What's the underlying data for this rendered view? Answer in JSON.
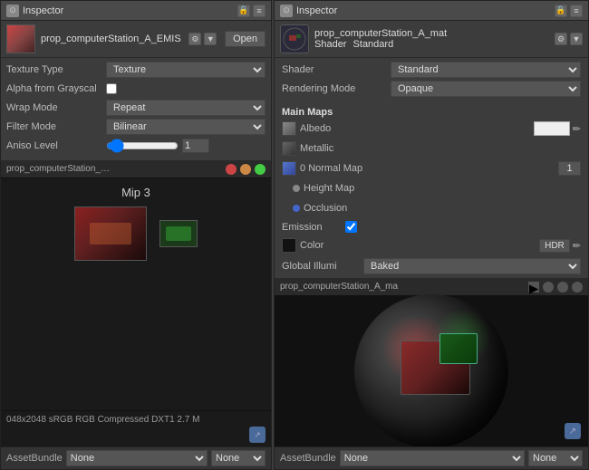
{
  "left_panel": {
    "title": "Inspector",
    "asset_name": "prop_computerStation_A_EMIS",
    "open_button": "Open",
    "fields": {
      "texture_type_label": "Texture Type",
      "texture_type_value": "Texture",
      "alpha_from_grayscale_label": "Alpha from Grayscal",
      "wrap_mode_label": "Wrap Mode",
      "wrap_mode_value": "Repeat",
      "filter_mode_label": "Filter Mode",
      "filter_mode_value": "Bilinear",
      "aniso_level_label": "Aniso Level",
      "aniso_level_value": "1"
    },
    "preview": {
      "title": "prop_computerStation_…",
      "mip_label": "Mip 3"
    },
    "status_text": "048x2048 sRGB  RGB Compressed DXT1   2.7 M",
    "asset_bundle": {
      "label": "AssetBundle",
      "none_option": "None",
      "none_option2": "None"
    }
  },
  "right_panel": {
    "title": "Inspector",
    "asset_name": "prop_computerStation_A_mat",
    "shader_label": "Shader",
    "shader_value": "Standard",
    "rendering_mode_label": "Rendering Mode",
    "rendering_mode_value": "Opaque",
    "main_maps_title": "Main Maps",
    "maps": {
      "albedo_label": "Albedo",
      "metallic_label": "Metallic",
      "normal_map_label": "Normal Map",
      "normal_map_value": "0",
      "normal_map_number": "1",
      "height_map_label": "Height Map",
      "occlusion_label": "Occlusion",
      "emission_label": "Emission",
      "color_label": "Color",
      "global_illum_label": "Global Illumi",
      "global_illum_value": "Baked"
    },
    "preview": {
      "title": "prop_computerStation_A_ma"
    },
    "asset_bundle": {
      "label": "AssetBundle",
      "none_option": "None",
      "none_option2": "None"
    }
  }
}
